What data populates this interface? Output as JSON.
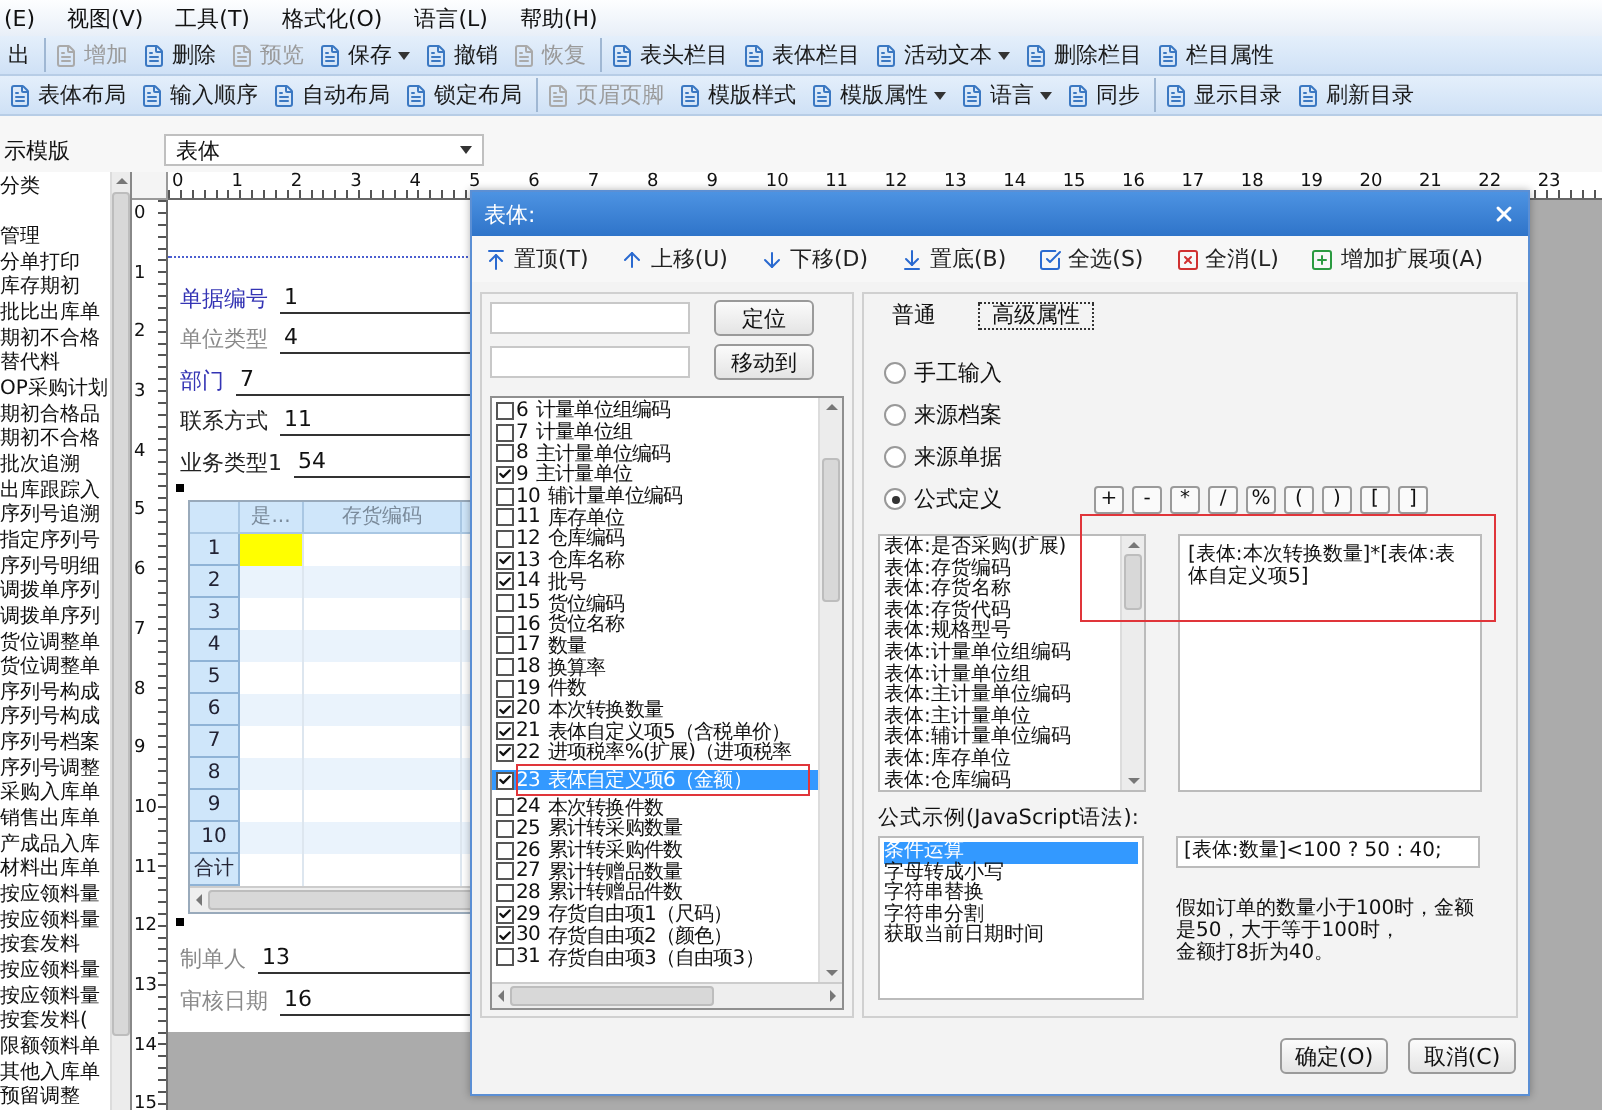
{
  "menu": [
    "(E)",
    "视图(V)",
    "工具(T)",
    "格式化(O)",
    "语言(L)",
    "帮助(H)"
  ],
  "toolbar_1": [
    [
      {
        "label": "出",
        "kind": "text",
        "disabled": false
      }
    ],
    [
      {
        "label": "增加",
        "kind": "button",
        "disabled": true
      },
      {
        "label": "删除",
        "kind": "button",
        "disabled": false
      },
      {
        "label": "预览",
        "kind": "button",
        "disabled": true
      },
      {
        "label": "保存",
        "kind": "dropdown",
        "disabled": false
      },
      {
        "label": "撤销",
        "kind": "button",
        "disabled": false
      },
      {
        "label": "恢复",
        "kind": "button",
        "disabled": true
      }
    ],
    [
      {
        "label": "表头栏目",
        "kind": "button",
        "disabled": false
      },
      {
        "label": "表体栏目",
        "kind": "button",
        "disabled": false
      },
      {
        "label": "活动文本",
        "kind": "dropdown",
        "disabled": false
      },
      {
        "label": "删除栏目",
        "kind": "button",
        "disabled": false
      },
      {
        "label": "栏目属性",
        "kind": "button",
        "disabled": false
      }
    ]
  ],
  "toolbar_2": [
    [
      {
        "label": "表体布局",
        "kind": "button",
        "disabled": false
      },
      {
        "label": "输入顺序",
        "kind": "button",
        "disabled": false
      },
      {
        "label": "自动布局",
        "kind": "button",
        "disabled": false
      },
      {
        "label": "锁定布局",
        "kind": "button",
        "disabled": false
      }
    ],
    [
      {
        "label": "页眉页脚",
        "kind": "button",
        "disabled": true
      },
      {
        "label": "模版样式",
        "kind": "button",
        "disabled": false
      },
      {
        "label": "模版属性",
        "kind": "dropdown",
        "disabled": false
      },
      {
        "label": "语言",
        "kind": "dropdown",
        "disabled": false
      },
      {
        "label": "同步",
        "kind": "button",
        "disabled": false
      }
    ],
    [
      {
        "label": "显示目录",
        "kind": "button",
        "disabled": false
      },
      {
        "label": "刷新目录",
        "kind": "button",
        "disabled": false
      }
    ]
  ],
  "template_row": {
    "label": "示模版",
    "select_value": "表体"
  },
  "tree": {
    "header": "分类",
    "items": [
      "管理",
      "分单打印",
      "库存期初",
      "批比出库单",
      "期初不合格",
      "替代料",
      "OP采购计划",
      "期初合格品",
      "期初不合格",
      "批次追溯",
      "出库跟踪入",
      "序列号追溯",
      "指定序列号",
      "序列号明细",
      "调拨单序列",
      "调拨单序列",
      "货位调整单",
      "货位调整单",
      "序列号构成",
      "序列号构成",
      "序列号档案",
      "序列号调整",
      "采购入库单",
      "销售出库单",
      "产成品入库",
      "材料出库单",
      "按应领料量",
      "按应领料量",
      "按套发料",
      "按应领料量",
      "按应领料量",
      "按套发料(",
      "限额领料单",
      "其他入库单",
      "预留调整"
    ]
  },
  "top_ruler": [
    "0",
    "1",
    "2",
    "3",
    "4",
    "5",
    "6",
    "7",
    "8",
    "9",
    "10",
    "11",
    "12",
    "13",
    "14",
    "15",
    "16",
    "17",
    "18",
    "19",
    "20",
    "21",
    "22",
    "23"
  ],
  "left_ruler": [
    "0",
    "1",
    "2",
    "3",
    "4",
    "5",
    "6",
    "7",
    "8",
    "9",
    "10",
    "11",
    "12",
    "13",
    "14",
    "15"
  ],
  "form": {
    "fields_top": [
      {
        "label": "单据编号",
        "value": "1",
        "color": "#3434b4"
      },
      {
        "label": "单位类型",
        "value": "4",
        "color": "#8a8a8a"
      },
      {
        "label": "部门",
        "value": "7",
        "color": "#3434b4"
      },
      {
        "label": "联系方式",
        "value": "11",
        "color": "#222222"
      },
      {
        "label": "业务类型1",
        "value": "54",
        "color": "#222222"
      }
    ],
    "grid": {
      "columns": [
        "是...",
        "存货编码"
      ],
      "rows": [
        {
          "label": "1",
          "current": true
        },
        {
          "label": "2",
          "current": false
        },
        {
          "label": "3",
          "current": false
        },
        {
          "label": "4",
          "current": false
        },
        {
          "label": "5",
          "current": false
        },
        {
          "label": "6",
          "current": false
        },
        {
          "label": "7",
          "current": false
        },
        {
          "label": "8",
          "current": false
        },
        {
          "label": "9",
          "current": false
        },
        {
          "label": "10",
          "current": false
        }
      ],
      "total_label": "合计"
    },
    "fields_bottom": [
      {
        "label": "制单人",
        "value": "13",
        "color": "#8a8a8a"
      },
      {
        "label": "审核日期",
        "value": "16",
        "color": "#8a8a8a"
      }
    ]
  },
  "dialog": {
    "title": "表体:",
    "toolbar": [
      "置顶(T)",
      "上移(U)",
      "下移(D)",
      "置底(B)",
      "全选(S)",
      "全消(L)",
      "增加扩展项(A)"
    ],
    "locate_button": "定位",
    "move_button": "移动到",
    "columns": [
      {
        "number": "6",
        "label": "计量单位组编码",
        "checked": false,
        "selected": false
      },
      {
        "number": "7",
        "label": "计量单位组",
        "checked": false,
        "selected": false
      },
      {
        "number": "8",
        "label": "主计量单位编码",
        "checked": false,
        "selected": false
      },
      {
        "number": "9",
        "label": "主计量单位",
        "checked": true,
        "selected": false
      },
      {
        "number": "10",
        "label": "辅计量单位编码",
        "checked": false,
        "selected": false
      },
      {
        "number": "11",
        "label": "库存单位",
        "checked": false,
        "selected": false
      },
      {
        "number": "12",
        "label": "仓库编码",
        "checked": false,
        "selected": false
      },
      {
        "number": "13",
        "label": "仓库名称",
        "checked": true,
        "selected": false
      },
      {
        "number": "14",
        "label": "批号",
        "checked": true,
        "selected": false
      },
      {
        "number": "15",
        "label": "货位编码",
        "checked": false,
        "selected": false
      },
      {
        "number": "16",
        "label": "货位名称",
        "checked": false,
        "selected": false
      },
      {
        "number": "17",
        "label": "数量",
        "checked": false,
        "selected": false
      },
      {
        "number": "18",
        "label": "换算率",
        "checked": false,
        "selected": false
      },
      {
        "number": "19",
        "label": "件数",
        "checked": false,
        "selected": false
      },
      {
        "number": "20",
        "label": "本次转换数量",
        "checked": true,
        "selected": false
      },
      {
        "number": "21",
        "label": "表体自定义项5（含税单价）",
        "checked": true,
        "selected": false
      },
      {
        "number": "22",
        "label": "进项税率%(扩展)（进项税率",
        "checked": true,
        "selected": false
      },
      {
        "number": "23",
        "label": "表体自定义项6（金额）",
        "checked": true,
        "selected": true
      },
      {
        "number": "24",
        "label": "本次转换件数",
        "checked": false,
        "selected": false
      },
      {
        "number": "25",
        "label": "累计转采购数量",
        "checked": false,
        "selected": false
      },
      {
        "number": "26",
        "label": "累计转采购件数",
        "checked": false,
        "selected": false
      },
      {
        "number": "27",
        "label": "累计转赠品数量",
        "checked": false,
        "selected": false
      },
      {
        "number": "28",
        "label": "累计转赠品件数",
        "checked": false,
        "selected": false
      },
      {
        "number": "29",
        "label": "存货自由项1（尺码）",
        "checked": true,
        "selected": false
      },
      {
        "number": "30",
        "label": "存货自由项2（颜色）",
        "checked": true,
        "selected": false
      },
      {
        "number": "31",
        "label": "存货自由项3（自由项3）",
        "checked": false,
        "selected": false
      }
    ],
    "tabs": [
      {
        "label": "普通",
        "selected": false
      },
      {
        "label": "高级属性",
        "selected": true
      }
    ],
    "sources": [
      {
        "label": "手工输入",
        "selected": false
      },
      {
        "label": "来源档案",
        "selected": false
      },
      {
        "label": "来源单据",
        "selected": false
      },
      {
        "label": "公式定义",
        "selected": true
      }
    ],
    "operators": [
      "+",
      "-",
      "*",
      "/",
      "%",
      "(",
      ")",
      "[",
      "]"
    ],
    "field_list": [
      "表体:是否采购(扩展)",
      "表体:存货编码",
      "表体:存货名称",
      "表体:存货代码",
      "表体:规格型号",
      "表体:计量单位组编码",
      "表体:计量单位组",
      "表体:主计量单位编码",
      "表体:主计量单位",
      "表体:辅计量单位编码",
      "表体:库存单位",
      "表体:仓库编码"
    ],
    "formula": "[表体:本次转换数量]*[表体:表体自定义项5]",
    "examples_label": "公式示例(JavaScript语法):",
    "examples": [
      {
        "label": "条件运算",
        "selected": true
      },
      {
        "label": "字母转成小写",
        "selected": false
      },
      {
        "label": "字符串替换",
        "selected": false
      },
      {
        "label": "字符串分割",
        "selected": false
      },
      {
        "label": "获取当前日期时间",
        "selected": false
      }
    ],
    "example_code": "[表体:数量]<100 ? 50 : 40;",
    "example_description": [
      "假如订单的数量小于100时，金额",
      "是50，大于等于100时，",
      "金额打8折为40。"
    ],
    "buttons": [
      "确定(O)",
      "取消(C)"
    ]
  }
}
